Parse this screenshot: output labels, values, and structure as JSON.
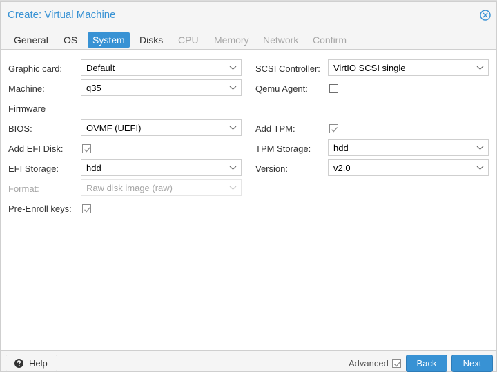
{
  "window": {
    "title": "Create: Virtual Machine"
  },
  "tabs": [
    {
      "label": "General",
      "state": "normal"
    },
    {
      "label": "OS",
      "state": "normal"
    },
    {
      "label": "System",
      "state": "active"
    },
    {
      "label": "Disks",
      "state": "normal"
    },
    {
      "label": "CPU",
      "state": "disabled"
    },
    {
      "label": "Memory",
      "state": "disabled"
    },
    {
      "label": "Network",
      "state": "disabled"
    },
    {
      "label": "Confirm",
      "state": "disabled"
    }
  ],
  "form": {
    "graphic_card": {
      "label": "Graphic card:",
      "value": "Default"
    },
    "machine": {
      "label": "Machine:",
      "value": "q35"
    },
    "scsi_controller": {
      "label": "SCSI Controller:",
      "value": "VirtIO SCSI single"
    },
    "qemu_agent": {
      "label": "Qemu Agent:",
      "checked": false
    },
    "firmware_heading": "Firmware",
    "bios": {
      "label": "BIOS:",
      "value": "OVMF (UEFI)"
    },
    "add_efi_disk": {
      "label": "Add EFI Disk:",
      "checked": true
    },
    "efi_storage": {
      "label": "EFI Storage:",
      "value": "hdd"
    },
    "format": {
      "label": "Format:",
      "value": "Raw disk image (raw)",
      "disabled": true
    },
    "pre_enroll_keys": {
      "label": "Pre-Enroll keys:",
      "checked": true
    },
    "add_tpm": {
      "label": "Add TPM:",
      "checked": true
    },
    "tpm_storage": {
      "label": "TPM Storage:",
      "value": "hdd"
    },
    "version": {
      "label": "Version:",
      "value": "v2.0"
    }
  },
  "footer": {
    "help_label": "Help",
    "advanced_label": "Advanced",
    "advanced_checked": true,
    "back_label": "Back",
    "next_label": "Next"
  },
  "colors": {
    "accent": "#3892d4",
    "header_bg": "#f5f5f5",
    "border": "#cfcfcf",
    "disabled_text": "#a6a6a6"
  },
  "icons": {
    "close": "close-circle-icon",
    "dropdown": "chevron-down-icon",
    "check": "checkmark-icon",
    "help": "question-circle-icon"
  }
}
